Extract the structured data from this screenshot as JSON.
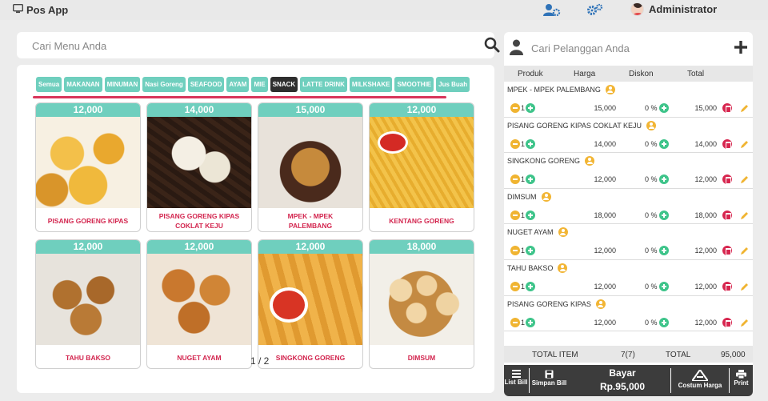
{
  "app": {
    "title": "Pos App",
    "user": "Administrator"
  },
  "header_icons": [
    "monitor-icon",
    "users-gear-icon",
    "gears-icon"
  ],
  "menu_search": {
    "placeholder": "Cari Menu Anda"
  },
  "categories": [
    {
      "label": "Semua",
      "active": false
    },
    {
      "label": "MAKANAN",
      "active": false
    },
    {
      "label": "MINUMAN",
      "active": false
    },
    {
      "label": "Nasi Goreng",
      "active": false
    },
    {
      "label": "SEAFOOD",
      "active": false
    },
    {
      "label": "AYAM",
      "active": false
    },
    {
      "label": "MIE",
      "active": false
    },
    {
      "label": "SNACK",
      "active": true
    },
    {
      "label": "LATTE DRINK",
      "active": false
    },
    {
      "label": "MILKSHAKE",
      "active": false
    },
    {
      "label": "SMOOTHIE",
      "active": false
    },
    {
      "label": "Jus Buah",
      "active": false
    }
  ],
  "products": [
    {
      "name": "PISANG GORENG KIPAS",
      "price": "12,000",
      "photo": "pisang"
    },
    {
      "name": "PISANG GORENG KIPAS COKLAT KEJU",
      "price": "14,000",
      "photo": "keju"
    },
    {
      "name": "MPEK - MPEK PALEMBANG",
      "price": "15,000",
      "photo": "mpek"
    },
    {
      "name": "KENTANG GORENG",
      "price": "12,000",
      "photo": "kentang"
    },
    {
      "name": "TAHU BAKSO",
      "price": "12,000",
      "photo": "tahu"
    },
    {
      "name": "NUGET AYAM",
      "price": "12,000",
      "photo": "nuget"
    },
    {
      "name": "SINGKONG GORENG",
      "price": "12,000",
      "photo": "singkong"
    },
    {
      "name": "DIMSUM",
      "price": "18,000",
      "photo": "dimsum"
    }
  ],
  "pager": "1 / 2",
  "customer_search": {
    "placeholder": "Cari Pelanggan Anda"
  },
  "cart_headers": {
    "produk": "Produk",
    "harga": "Harga",
    "diskon": "Diskon",
    "total": "Total"
  },
  "cart": [
    {
      "name": "MPEK - MPEK PALEMBANG",
      "qty": "1",
      "harga": "15,000",
      "diskon": "0 %",
      "total": "15,000"
    },
    {
      "name": "PISANG GORENG KIPAS COKLAT KEJU",
      "qty": "1",
      "harga": "14,000",
      "diskon": "0 %",
      "total": "14,000"
    },
    {
      "name": "SINGKONG GORENG",
      "qty": "1",
      "harga": "12,000",
      "diskon": "0 %",
      "total": "12,000"
    },
    {
      "name": "DIMSUM",
      "qty": "1",
      "harga": "18,000",
      "diskon": "0 %",
      "total": "18,000"
    },
    {
      "name": "NUGET AYAM",
      "qty": "1",
      "harga": "12,000",
      "diskon": "0 %",
      "total": "12,000"
    },
    {
      "name": "TAHU BAKSO",
      "qty": "1",
      "harga": "12,000",
      "diskon": "0 %",
      "total": "12,000"
    },
    {
      "name": "PISANG GORENG KIPAS",
      "qty": "1",
      "harga": "12,000",
      "diskon": "0 %",
      "total": "12,000"
    }
  ],
  "summary": {
    "total_item_label": "TOTAL ITEM",
    "total_item_value": "7(7)",
    "total_label": "TOTAL",
    "total_value": "95,000"
  },
  "actions": {
    "list_bill": "List Bill",
    "simpan_bill": "Simpan Bill",
    "bayar_label": "Bayar",
    "bayar_amount": "Rp.95,000",
    "costum_harga": "Costum Harga",
    "print": "Print"
  },
  "colors": {
    "accent": "#6fcfbe",
    "product_name": "#d3264f",
    "active_category": "#2e2e2e",
    "underline": "#d8365b",
    "action_bar": "#3c3c3c"
  }
}
